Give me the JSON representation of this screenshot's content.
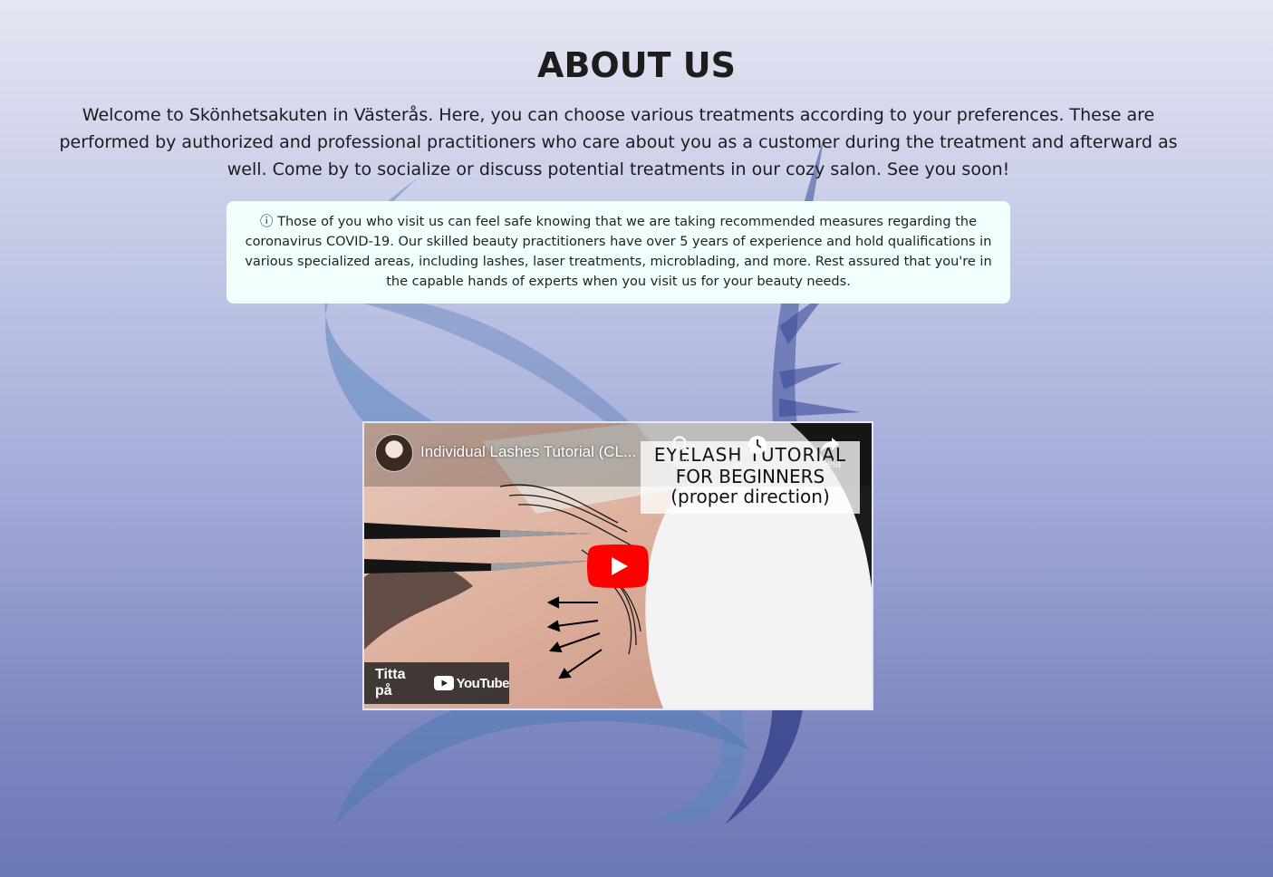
{
  "about": {
    "title": "ABOUT US",
    "intro": "Welcome to Skönhetsakuten in Västerås. Here, you can choose various treatments according to your preferences. These are performed by authorized and professional practitioners who care about you as a customer during the treatment and afterward as well. Come by to socialize or discuss potential treatments in our cozy salon. See you soon!",
    "notice_icon": "ⓘ",
    "notice": "Those of you who visit us can feel safe knowing that we are taking recommended measures regarding the coronavirus COVID-19. Our skilled beauty practitioners have over 5 years of experience and hold qualifications in various specialized areas, including lashes, laser treatments, microblading, and more. Rest assured that you're in the capable hands of experts when you visit us for your beauty needs."
  },
  "video": {
    "title": "Individual Lashes Tutorial (CL...",
    "overlay_line1": "EYELASH TUTORIAL",
    "overlay_line2": "FOR BEGINNERS",
    "overlay_line3": "(proper direction)",
    "actions": [
      {
        "label": "Sök",
        "icon": "search-icon"
      },
      {
        "label": "Titta senare",
        "icon": "clock-icon"
      },
      {
        "label": "Dela",
        "icon": "share-icon"
      }
    ],
    "watch_on_label": "Titta på",
    "youtube_label": "YouTube"
  },
  "colors": {
    "notice_bg": "#f1fffd",
    "logo_blue": "#4f7bb6",
    "logo_dark": "#2f3a86",
    "youtube_red": "#ff0000"
  }
}
